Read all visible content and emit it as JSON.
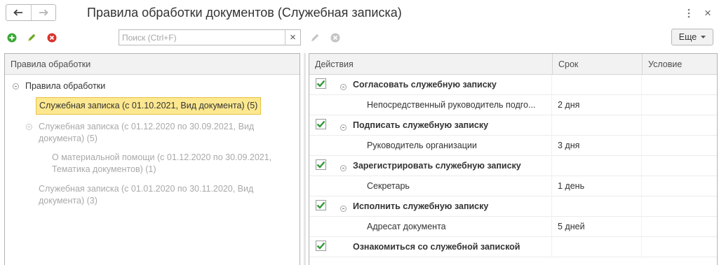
{
  "header": {
    "title": "Правила обработки документов (Служебная записка)",
    "back_icon": "arrow-left-icon",
    "forward_icon": "arrow-right-icon",
    "more_icon": "vertical-dots-icon",
    "close_label": "×"
  },
  "toolbar": {
    "search_placeholder": "Поиск (Ctrl+F)",
    "clear_label": "×",
    "more_button_label": "Еще",
    "colors": {
      "add": "#3aa935",
      "edit": "#6aa520",
      "delete": "#d9332c",
      "disabled": "#c4c4c4"
    }
  },
  "left_panel": {
    "header": "Правила обработки",
    "tree": [
      {
        "label": "Правила обработки",
        "level": 0,
        "expanded": true,
        "style": "normal"
      },
      {
        "label": "Служебная записка (с 01.10.2021, Вид документа) (5)",
        "level": 1,
        "style": "selected"
      },
      {
        "label": "Служебная записка (с 01.12.2020 по 30.09.2021, Вид документа) (5)",
        "level": 1,
        "expanded": true,
        "style": "grey"
      },
      {
        "label": "О материальной помощи (с 01.12.2020 по 30.09.2021, Тематика документов) (1)",
        "level": 2,
        "style": "grey"
      },
      {
        "label": "Служебная записка (с 01.01.2020 по 30.11.2020, Вид документа) (3)",
        "level": 1,
        "style": "grey"
      }
    ]
  },
  "right_panel": {
    "columns": [
      "Действия",
      "Срок",
      "Условие"
    ],
    "rows": [
      {
        "action": "Согласовать служебную записку",
        "term": "",
        "group": true,
        "checked": true,
        "toggle": true
      },
      {
        "action": "Непосредственный руководитель подго...",
        "term": "2 дня",
        "group": false
      },
      {
        "action": "Подписать служебную записку",
        "term": "",
        "group": true,
        "checked": true,
        "toggle": true
      },
      {
        "action": "Руководитель организации",
        "term": "3 дня",
        "group": false
      },
      {
        "action": "Зарегистрировать служебную записку",
        "term": "",
        "group": true,
        "checked": true,
        "toggle": true
      },
      {
        "action": "Секретарь",
        "term": "1 день",
        "group": false
      },
      {
        "action": "Исполнить служебную записку",
        "term": "",
        "group": true,
        "checked": true,
        "toggle": true
      },
      {
        "action": "Адресат документа",
        "term": "5 дней",
        "group": false
      },
      {
        "action": "Ознакомиться со служебной запиской",
        "term": "",
        "group": true,
        "checked": true,
        "toggle": false
      }
    ]
  }
}
